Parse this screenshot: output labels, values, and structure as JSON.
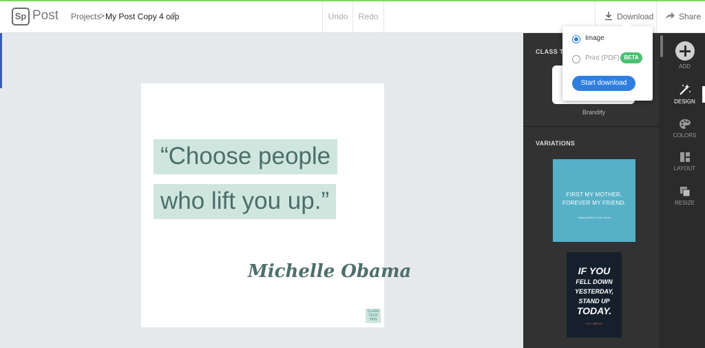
{
  "header": {
    "logo": "Sp",
    "app_name": "Post",
    "breadcrumb_projects": "Projects",
    "breadcrumb_separator": ">",
    "project_title": "My Post Copy 4 cop",
    "undo_label": "Undo",
    "redo_label": "Redo",
    "download_label": "Download",
    "share_label": "Share"
  },
  "post": {
    "quote_line1": "“Choose people",
    "quote_line2": "who lift you up.”",
    "author": "Michelle Obama",
    "badge": "CLASS TECH TIPS",
    "highlight_color": "#cfe6df",
    "text_color": "#4c6e68"
  },
  "panel": {
    "section_brand": "CLASS TECH TIPS",
    "brand_label": "Brandify",
    "section_variations": "VARIATIONS",
    "variation1_text": "FIRST MY MOTHER, FOREVER MY FRIEND.",
    "variation1_sub": "Happy Mother's Day, Mom!",
    "variation2_line1": "IF YOU",
    "variation2_line2": "FELL DOWN",
    "variation2_line3": "YESTERDAY,",
    "variation2_line4": "STAND UP",
    "variation2_line5": "TODAY.",
    "variation2_sub": "H.G. WELLS"
  },
  "rail": {
    "add": "ADD",
    "design": "DESIGN",
    "colors": "COLORS",
    "layout": "LAYOUT",
    "resize": "RESIZE"
  },
  "download_popup": {
    "option_image": "Image",
    "option_pdf": "Print (PDF)",
    "beta": "BETA",
    "start_button": "Start download",
    "selected": "Image",
    "accent_color": "#2f7fe0"
  }
}
